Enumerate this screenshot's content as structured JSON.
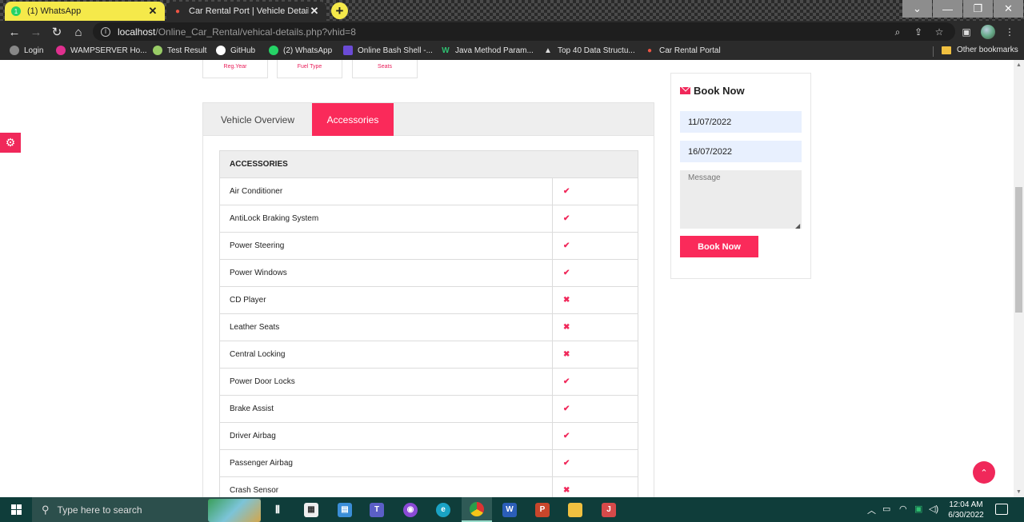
{
  "browser": {
    "tabs": [
      {
        "title": "(1) WhatsApp",
        "badge": "1",
        "active": true
      },
      {
        "title": "Car Rental Port | Vehicle Details",
        "active": false
      }
    ],
    "new_tab_label": "+",
    "close_glyph": "✕",
    "url_host": "localhost",
    "url_path": "/Online_Car_Rental/vehical-details.php?vhid=8",
    "window_controls": [
      "⌄",
      "—",
      "❐",
      "✕"
    ],
    "bookmarks": [
      {
        "label": "Login",
        "icon": "globe-icon"
      },
      {
        "label": "WAMPSERVER Ho...",
        "icon": "wamp-icon"
      },
      {
        "label": "Test Result",
        "icon": "test-icon"
      },
      {
        "label": "GitHub",
        "icon": "github-icon"
      },
      {
        "label": "(2) WhatsApp",
        "icon": "whatsapp-icon"
      },
      {
        "label": "Online Bash Shell -...",
        "icon": "bash-icon"
      },
      {
        "label": "Java Method Param...",
        "icon": "java-icon"
      },
      {
        "label": "Top 40 Data Structu...",
        "icon": "mountain-icon"
      },
      {
        "label": "Car Rental Portal",
        "icon": "car-icon"
      }
    ],
    "other_bookmarks": "Other bookmarks"
  },
  "page": {
    "spec_labels": [
      "Reg.Year",
      "Fuel Type",
      "Seats"
    ],
    "tabs": {
      "overview": "Vehicle Overview",
      "accessories": "Accessories"
    },
    "accessories_header": "ACCESSORIES",
    "accessories": [
      {
        "name": "Air Conditioner",
        "available": true,
        "mark": "✔"
      },
      {
        "name": "AntiLock Braking System",
        "available": true,
        "mark": "✔"
      },
      {
        "name": "Power Steering",
        "available": true,
        "mark": "✔"
      },
      {
        "name": "Power Windows",
        "available": true,
        "mark": "✔"
      },
      {
        "name": "CD Player",
        "available": false,
        "mark": "✖"
      },
      {
        "name": "Leather Seats",
        "available": false,
        "mark": "✖"
      },
      {
        "name": "Central Locking",
        "available": false,
        "mark": "✖"
      },
      {
        "name": "Power Door Locks",
        "available": true,
        "mark": "✔"
      },
      {
        "name": "Brake Assist",
        "available": true,
        "mark": "✔"
      },
      {
        "name": "Driver Airbag",
        "available": true,
        "mark": "✔"
      },
      {
        "name": "Passenger Airbag",
        "available": true,
        "mark": "✔"
      },
      {
        "name": "Crash Sensor",
        "available": false,
        "mark": "✖"
      }
    ],
    "booking": {
      "title": "Book Now",
      "from_date": "11/07/2022",
      "to_date": "16/07/2022",
      "message_placeholder": "Message",
      "submit_label": "Book Now"
    },
    "accent_color": "#fa2a5a"
  },
  "taskbar": {
    "search_placeholder": "Type here to search",
    "time": "12:04 AM",
    "date": "6/30/2022"
  }
}
